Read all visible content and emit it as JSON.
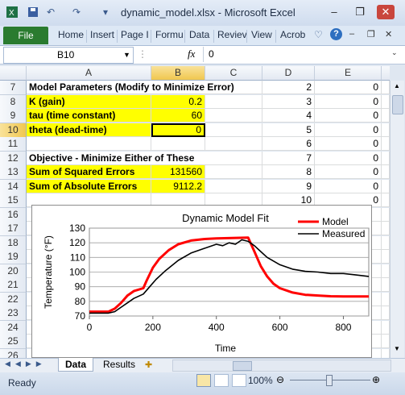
{
  "window": {
    "title": "dynamic_model.xlsx - Microsoft Excel",
    "quick_access": {
      "save_icon": "save-icon",
      "undo_icon": "undo-icon",
      "redo_icon": "redo-icon"
    },
    "controls": {
      "minimize": "–",
      "restore": "❐",
      "close": "✕"
    }
  },
  "ribbon": {
    "file_tab": "File",
    "tabs": [
      "Home",
      "Insert",
      "Page I",
      "Formu",
      "Data",
      "Reviev",
      "View",
      "Acrob"
    ],
    "help": "?"
  },
  "formula_bar": {
    "name_box": "B10",
    "fx": "fx",
    "value": "0"
  },
  "columns": [
    "A",
    "B",
    "C",
    "D",
    "E"
  ],
  "rows": [
    {
      "n": "7",
      "a": "Model Parameters (Modify to Minimize Error)",
      "b": "",
      "d": "2",
      "e": "0",
      "style": "bold"
    },
    {
      "n": "8",
      "a": "K (gain)",
      "b": "0.2",
      "d": "3",
      "e": "0",
      "style": "yellow"
    },
    {
      "n": "9",
      "a": "tau (time constant)",
      "b": "60",
      "d": "4",
      "e": "0",
      "style": "yellow"
    },
    {
      "n": "10",
      "a": "theta (dead-time)",
      "b": "0",
      "d": "5",
      "e": "0",
      "style": "yellow-active"
    },
    {
      "n": "11",
      "a": "",
      "b": "",
      "d": "6",
      "e": "0",
      "style": ""
    },
    {
      "n": "12",
      "a": "Objective - Minimize Either of These",
      "b": "",
      "d": "7",
      "e": "0",
      "style": "bold"
    },
    {
      "n": "13",
      "a": "Sum of Squared Errors",
      "b": "131560",
      "d": "8",
      "e": "0",
      "style": "yellow"
    },
    {
      "n": "14",
      "a": "Sum of Absolute Errors",
      "b": "9112.2",
      "d": "9",
      "e": "0",
      "style": "yellow"
    },
    {
      "n": "15",
      "a": "",
      "b": "",
      "d": "10",
      "e": "0",
      "style": ""
    },
    {
      "n": "16"
    },
    {
      "n": "17"
    },
    {
      "n": "18"
    },
    {
      "n": "19"
    },
    {
      "n": "20"
    },
    {
      "n": "21"
    },
    {
      "n": "22"
    },
    {
      "n": "23"
    },
    {
      "n": "24"
    },
    {
      "n": "25"
    },
    {
      "n": "26"
    }
  ],
  "sheets": {
    "tabs": [
      "Data",
      "Results"
    ],
    "active": "Data"
  },
  "status": {
    "ready": "Ready",
    "zoom": "100%"
  },
  "colors": {
    "model": "#ff0000",
    "measured": "#000000",
    "file_tab": "#2a7b2f",
    "highlight": "#ffff00"
  },
  "chart_data": {
    "type": "line",
    "title": "Dynamic Model Fit",
    "xlabel": "Time",
    "ylabel": "Temperature (°F)",
    "xlim": [
      0,
      880
    ],
    "ylim": [
      70,
      130
    ],
    "xticks": [
      0,
      200,
      400,
      600,
      800
    ],
    "yticks": [
      70,
      80,
      90,
      100,
      110,
      120,
      130
    ],
    "legend": "top-right",
    "grid": true,
    "series": [
      {
        "name": "Model",
        "color": "#ff0000",
        "x": [
          0,
          60,
          80,
          100,
          120,
          140,
          170,
          180,
          200,
          220,
          250,
          280,
          320,
          360,
          400,
          450,
          500,
          520,
          540,
          560,
          580,
          600,
          640,
          680,
          720,
          760,
          800,
          880
        ],
        "y": [
          73,
          73,
          75,
          79,
          84,
          87,
          89,
          94,
          103,
          109,
          115,
          119,
          121.5,
          122.5,
          123,
          123.3,
          123.5,
          114,
          104,
          97,
          92,
          89,
          86,
          84.5,
          84,
          83.5,
          83.3,
          83.3
        ]
      },
      {
        "name": "Measured",
        "color": "#000000",
        "x": [
          0,
          60,
          80,
          100,
          120,
          140,
          170,
          190,
          210,
          240,
          280,
          320,
          360,
          400,
          420,
          440,
          460,
          480,
          500,
          520,
          540,
          560,
          600,
          640,
          680,
          720,
          760,
          800,
          840,
          880
        ],
        "y": [
          72,
          72,
          73,
          76,
          79,
          82,
          85,
          90,
          95,
          101,
          108,
          113,
          116,
          119,
          118,
          120,
          119,
          122,
          121,
          118,
          114,
          110,
          105,
          102,
          100.5,
          100,
          99,
          99,
          98,
          97
        ]
      }
    ]
  }
}
